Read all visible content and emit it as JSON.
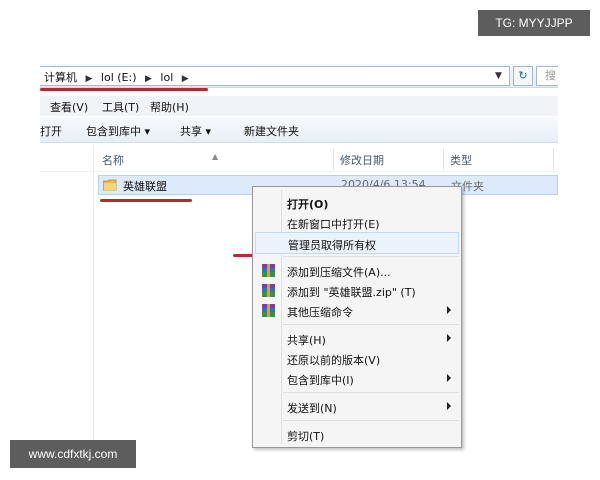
{
  "watermark_top": "TG: MYYJJPP",
  "watermark_bottom": "www.cdfxtkj.com",
  "address": {
    "crumbs": [
      "计算机",
      "lol (E:)",
      "lol"
    ],
    "search_placeholder": "搜"
  },
  "menu": {
    "view": "查看(V)",
    "tools": "工具(T)",
    "help": "帮助(H)"
  },
  "toolbar": {
    "open": "打开",
    "include_library": "包含到库中 ▾",
    "share": "共享 ▾",
    "new_folder": "新建文件夹"
  },
  "columns": {
    "name": "名称",
    "modified": "修改日期",
    "type": "类型"
  },
  "file": {
    "name": "英雄联盟",
    "date": "2020/4/6 13:54",
    "type": "文件夹"
  },
  "context_menu": {
    "open": "打开(O)",
    "open_new_window": "在新窗口中打开(E)",
    "take_ownership": "管理员取得所有权",
    "add_to_archive": "添加到压缩文件(A)...",
    "add_to_zip": "添加到 \"英雄联盟.zip\" (T)",
    "other_compress": "其他压缩命令",
    "share": "共享(H)",
    "restore_versions": "还原以前的版本(V)",
    "include_library": "包含到库中(I)",
    "send_to": "发送到(N)",
    "cut": "剪切(T)"
  },
  "colors": {
    "annotation_red": "#c4252d",
    "selection_blue": "#dceafc",
    "watermark_bg": "#5d5d5d"
  }
}
